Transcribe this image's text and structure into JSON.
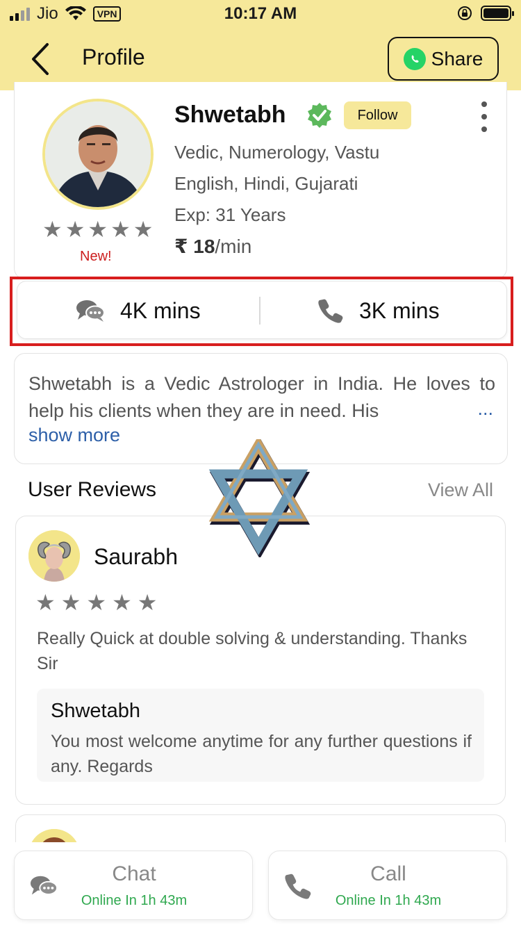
{
  "status_bar": {
    "carrier": "Jio",
    "vpn": "VPN",
    "time": "10:17 AM"
  },
  "header": {
    "title": "Profile",
    "share_label": "Share"
  },
  "profile": {
    "name": "Shwetabh",
    "follow_label": "Follow",
    "skills": "Vedic, Numerology, Vastu",
    "languages": "English, Hindi, Gujarati",
    "experience": "Exp: 31 Years",
    "price_amount": "₹ 18",
    "price_unit": "/min",
    "new_tag": "New!",
    "rating_stars": 5
  },
  "stats": {
    "chat_minutes": "4K mins",
    "call_minutes": "3K mins"
  },
  "about": {
    "text": "Shwetabh is a Vedic Astrologer in India. He loves to help his clients when they are in need. His",
    "ellipsis": "...",
    "show_more": "show more"
  },
  "reviews": {
    "title": "User Reviews",
    "view_all": "View All",
    "items": [
      {
        "user": "Saurabh",
        "stars": 5,
        "text": "Really Quick at double solving & understanding. Thanks Sir",
        "reply_name": "Shwetabh",
        "reply_text": "You most welcome anytime for any further questions if any. Regards"
      }
    ]
  },
  "actions": {
    "chat_label": "Chat",
    "chat_status": "Online In 1h 43m",
    "call_label": "Call",
    "call_status": "Online In 1h 43m"
  },
  "colors": {
    "header_bg": "#f6e89a",
    "highlight_border": "#d81e1e",
    "verified_green": "#5cb85c",
    "online_green": "#2fa84f",
    "link_blue": "#2d5fa8"
  }
}
